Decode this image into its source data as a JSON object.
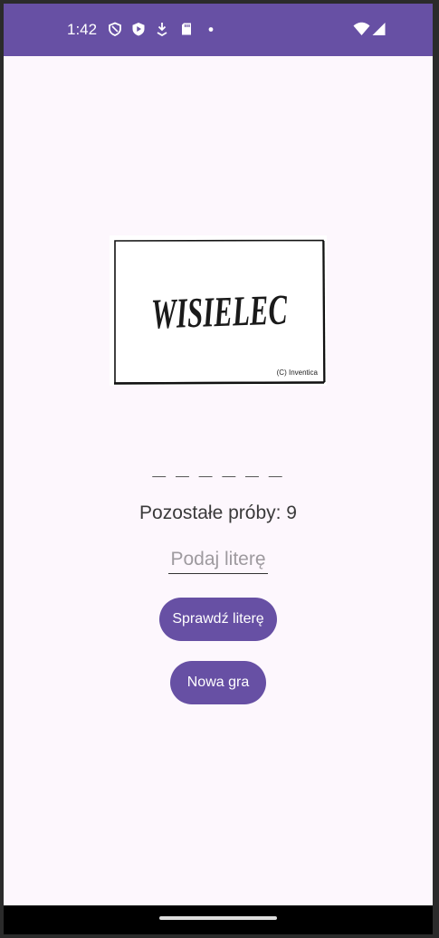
{
  "status_bar": {
    "time": "1:42",
    "background": "#6750a4",
    "left_icons": [
      "shield-outline-icon",
      "shield-play-icon",
      "download-icon",
      "sd-card-icon",
      "dot-icon"
    ],
    "right_icons": [
      "wifi-icon",
      "signal-icon"
    ]
  },
  "app": {
    "logo": {
      "text": "WISIELEC",
      "credit": "(C) Inventica"
    },
    "word_display": "_ _ _ _ _ _",
    "remaining_tries": "Pozostałe próby: 9",
    "letter_input": {
      "placeholder": "Podaj literę",
      "value": ""
    },
    "check_button_label": "Sprawdź literę",
    "new_game_button_label": "Nowa gra",
    "accent_color": "#6750a4",
    "background_color": "#fdf7fd"
  }
}
